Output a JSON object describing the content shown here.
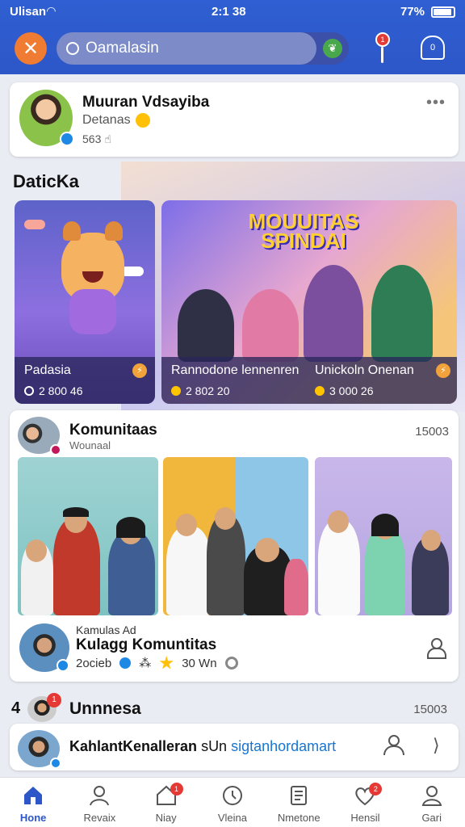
{
  "status_bar": {
    "carrier": "Ulisan",
    "time": "2:1 38",
    "battery": "77%"
  },
  "header": {
    "search_placeholder": "Oamalasin",
    "pin_badge": "1",
    "bell_badge": "0"
  },
  "profile": {
    "name": "Muuran Vdsayiba",
    "subtitle": "Detanas",
    "count": "563"
  },
  "featured": {
    "title": "DaticKa",
    "cards": [
      {
        "title": "Padasia",
        "meta": "2 800 46"
      },
      {
        "banner": "MOUUITAS SPINDAI",
        "title": "Rannodone lennenren",
        "meta": "2 802 20"
      },
      {
        "title": "Unickoln Onenan",
        "meta": "3 000 26"
      }
    ]
  },
  "community": {
    "title": "Komunitaas",
    "subtitle": "Wounaal",
    "count": "15003",
    "post": {
      "kicker": "Kamulas Ad",
      "name": "Kulagg Komuntitas",
      "meta_1": "2ocieb",
      "meta_2": "30 Wn"
    }
  },
  "section3": {
    "number": "4",
    "badge": "1",
    "title": "Unnnesa",
    "count": "15003",
    "row_text_1": "KahlantKenalleran",
    "row_text_2": "sUn",
    "row_link": "sigtanhordamart"
  },
  "nav": [
    {
      "label": "Hone",
      "icon": "home-icon",
      "active": true
    },
    {
      "label": "Revaix",
      "icon": "person-icon"
    },
    {
      "label": "Niay",
      "icon": "house-outline-icon",
      "badge": "1"
    },
    {
      "label": "Vleina",
      "icon": "clock-icon"
    },
    {
      "label": "Nmetone",
      "icon": "document-icon"
    },
    {
      "label": "Hensil",
      "icon": "heart-icon",
      "badge": "2"
    },
    {
      "label": "Gari",
      "icon": "user-icon"
    }
  ],
  "colors": {
    "primary": "#2d57c8",
    "accent": "#f07b33",
    "badge": "#e53935"
  }
}
